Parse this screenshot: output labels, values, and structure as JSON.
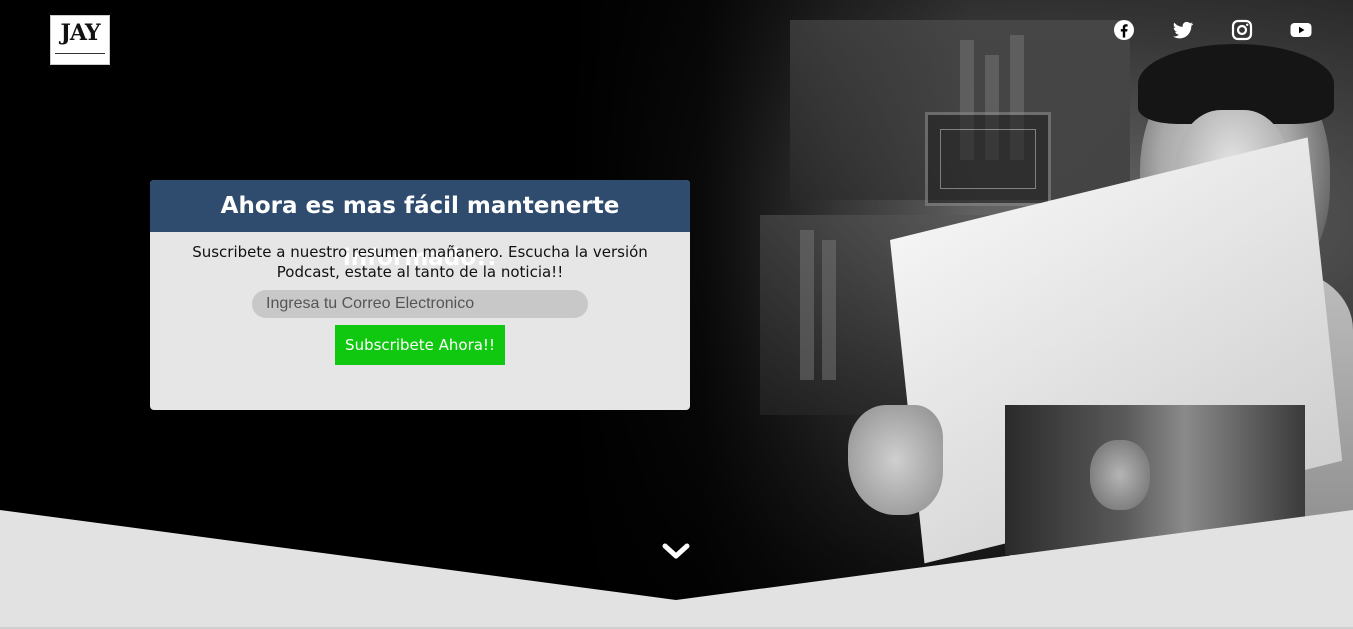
{
  "header": {
    "logo_text": "JAY"
  },
  "social": [
    {
      "name": "facebook"
    },
    {
      "name": "twitter"
    },
    {
      "name": "instagram"
    },
    {
      "name": "youtube"
    }
  ],
  "subscribe": {
    "title": "Ahora es mas fácil mantenerte informado!!",
    "description": "Suscribete a nuestro resumen mañanero. Escucha la versión Podcast, estate al tanto de la noticia!!",
    "email_placeholder": "Ingresa tu Correo Electronico",
    "button_label": "Subscribete Ahora!!"
  },
  "colors": {
    "header_bg": "#2f4b6d",
    "button_bg": "#10c80f",
    "card_bg": "#e6e6e6",
    "band_bg": "#e2e2e2"
  },
  "scroll": {
    "icon": "chevron-down-icon"
  }
}
